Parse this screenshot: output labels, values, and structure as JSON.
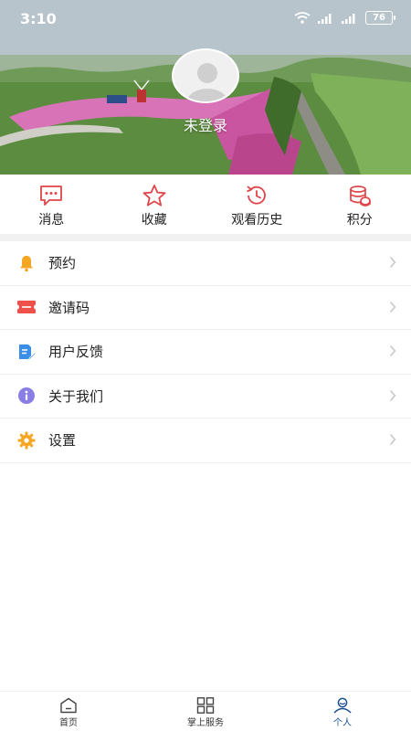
{
  "status_bar": {
    "time": "3:10",
    "battery": "76",
    "icons": [
      "wifi-icon",
      "signal-icon",
      "signal-icon",
      "battery-icon"
    ]
  },
  "profile": {
    "login_status": "未登录",
    "avatar_icon": "default-avatar-icon"
  },
  "quick_actions": [
    {
      "label": "消息",
      "icon": "message-icon"
    },
    {
      "label": "收藏",
      "icon": "star-icon"
    },
    {
      "label": "观看历史",
      "icon": "history-clock-icon"
    },
    {
      "label": "积分",
      "icon": "coins-icon"
    }
  ],
  "menu": [
    {
      "label": "预约",
      "icon": "bell-icon",
      "color": "#f5a623"
    },
    {
      "label": "邀请码",
      "icon": "ticket-icon",
      "color": "#f0504a"
    },
    {
      "label": "用户反馈",
      "icon": "feedback-edit-icon",
      "color": "#3a8ee6"
    },
    {
      "label": "关于我们",
      "icon": "info-icon",
      "color": "#8a7de6"
    },
    {
      "label": "设置",
      "icon": "gear-icon",
      "color": "#f5a623"
    }
  ],
  "bottom_nav": [
    {
      "label": "首页",
      "icon": "home-icon",
      "active": false
    },
    {
      "label": "掌上服务",
      "icon": "grid-icon",
      "active": false
    },
    {
      "label": "个人",
      "icon": "person-icon",
      "active": true
    }
  ],
  "colors": {
    "accent_red": "#e0454a",
    "active_nav": "#1a4f8f"
  }
}
